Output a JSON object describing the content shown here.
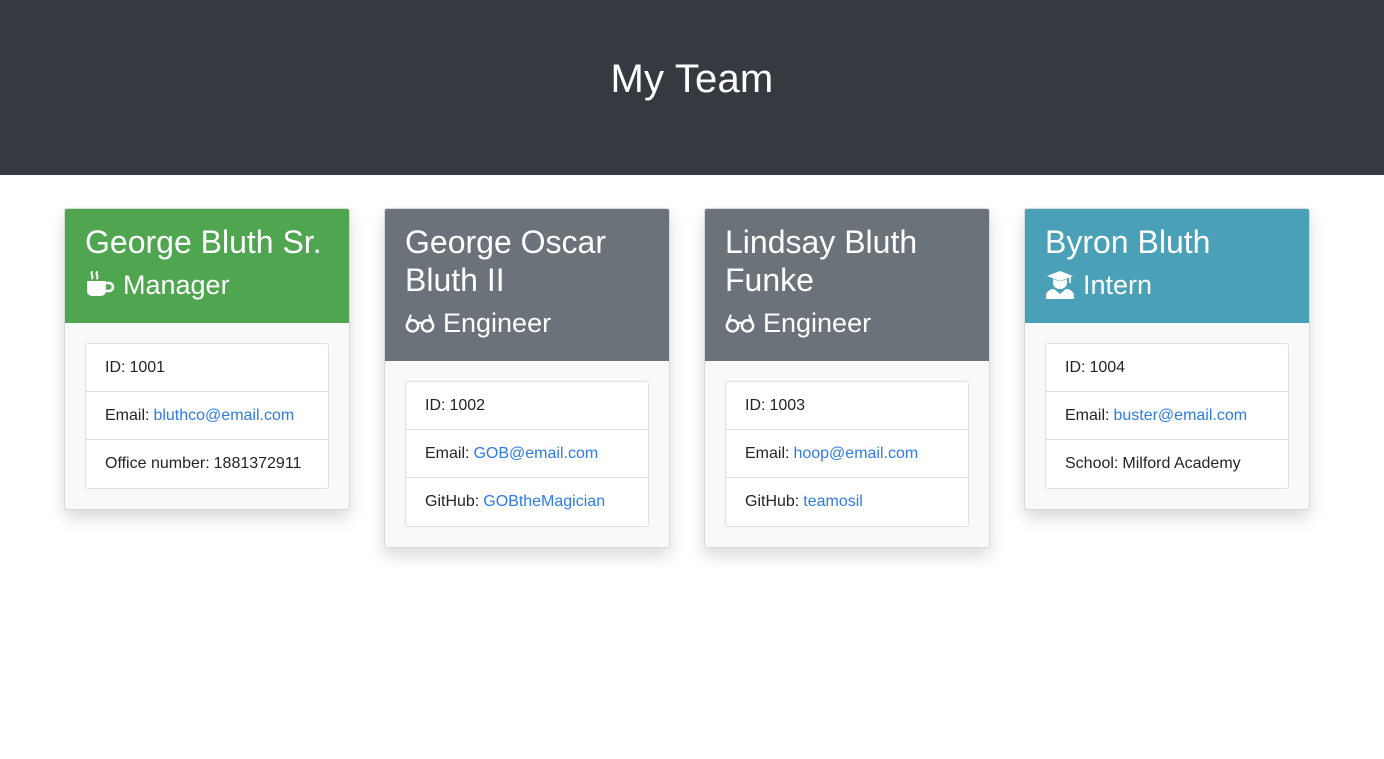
{
  "header": {
    "title": "My Team"
  },
  "colors": {
    "header_bg": "#343a40",
    "manager": "#50a550",
    "engineer": "#6c727a",
    "intern": "#4aa0b6",
    "link": "#2f7be8"
  },
  "cards": [
    {
      "name": "George Bluth Sr.",
      "role": "Manager",
      "icon": "mug-hot-icon",
      "id_label": "ID:",
      "id": "1001",
      "email_label": "Email:",
      "email": "bluthco@email.com",
      "extra_label": "Office number:",
      "extra": "1881372911"
    },
    {
      "name": "George Oscar Bluth II",
      "role": "Engineer",
      "icon": "glasses-icon",
      "id_label": "ID:",
      "id": "1002",
      "email_label": "Email:",
      "email": "GOB@email.com",
      "extra_label": "GitHub:",
      "extra": "GOBtheMagician"
    },
    {
      "name": "Lindsay Bluth Funke",
      "role": "Engineer",
      "icon": "glasses-icon",
      "id_label": "ID:",
      "id": "1003",
      "email_label": "Email:",
      "email": "hoop@email.com",
      "extra_label": "GitHub:",
      "extra": "teamosil"
    },
    {
      "name": "Byron Bluth",
      "role": "Intern",
      "icon": "graduate-icon",
      "id_label": "ID:",
      "id": "1004",
      "email_label": "Email:",
      "email": "buster@email.com",
      "extra_label": "School:",
      "extra": "Milford Academy"
    }
  ]
}
